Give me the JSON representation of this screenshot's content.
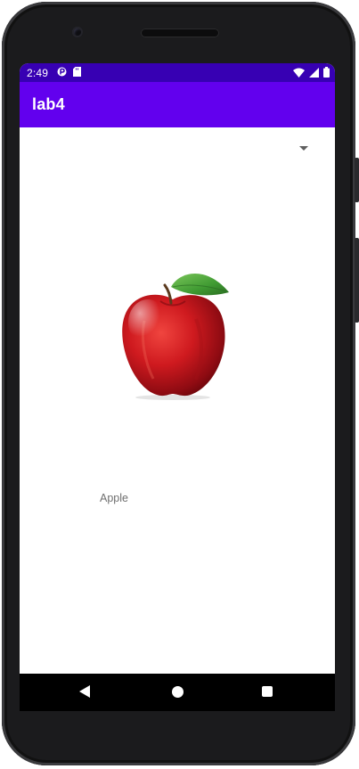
{
  "status_bar": {
    "time": "2:49",
    "icons": [
      "sync-icon",
      "sd-card-icon",
      "wifi-icon",
      "signal-icon",
      "battery-icon"
    ],
    "background_color": "#3700b3"
  },
  "app_bar": {
    "title": "lab4",
    "background_color": "#6200ee"
  },
  "spinner": {
    "selected_value": "",
    "icon": "dropdown-arrow-icon"
  },
  "main": {
    "image_icon": "apple-image",
    "label": "Apple"
  },
  "navigation_bar": {
    "buttons": [
      "back-button",
      "home-button",
      "recents-button"
    ]
  }
}
